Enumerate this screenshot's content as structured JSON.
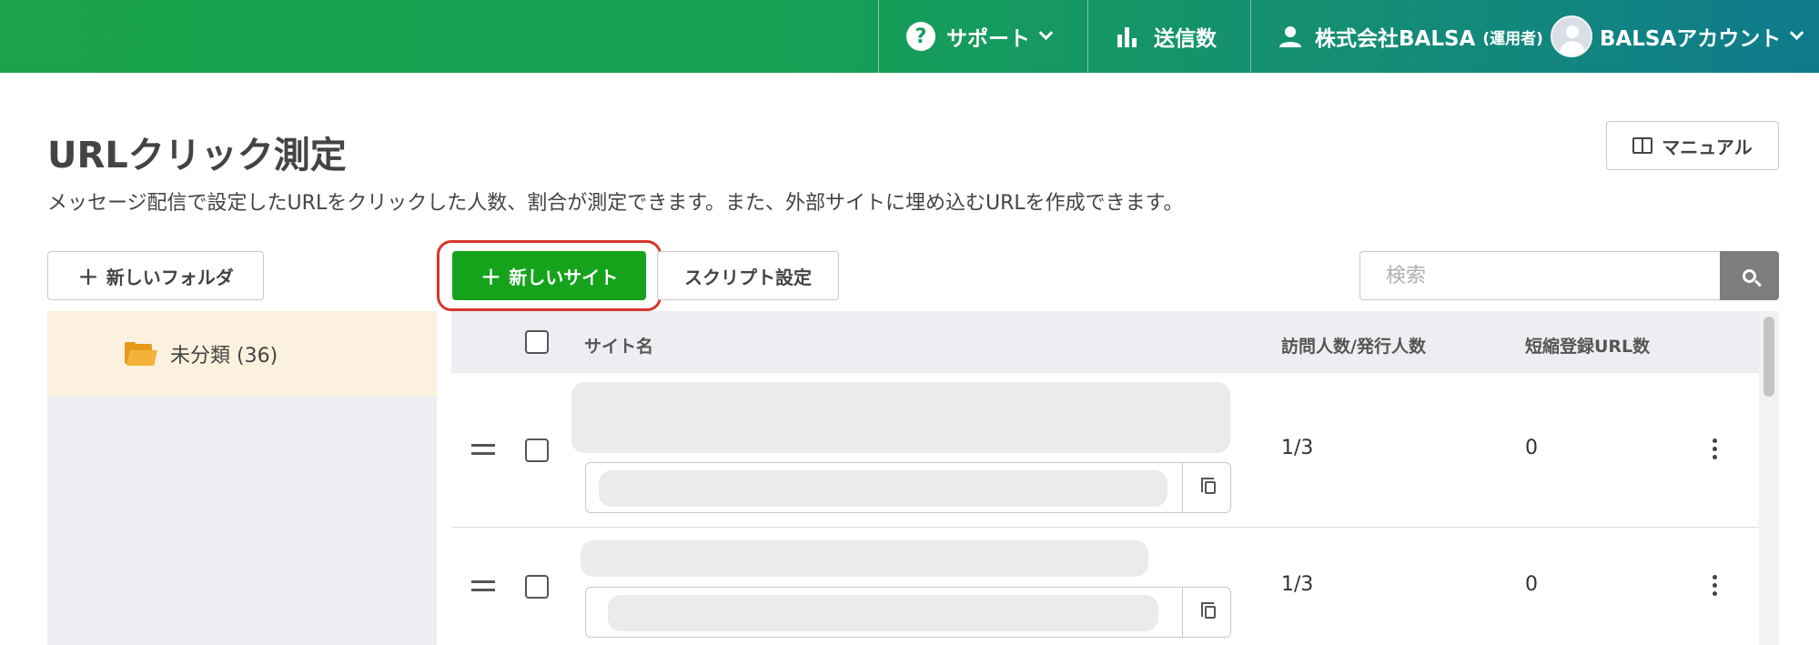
{
  "header": {
    "support_label": "サポート",
    "sends_label": "送信数",
    "company_label": "株式会社BALSA",
    "company_role": "(運用者)",
    "account_label": "BALSAアカウント"
  },
  "page": {
    "title": "URLクリック測定",
    "description": "メッセージ配信で設定したURLをクリックした人数、割合が測定できます。また、外部サイトに埋め込むURLを作成できます。",
    "manual_label": "マニュアル"
  },
  "toolbar": {
    "new_folder_label": "新しいフォルダ",
    "new_site_label": "新しいサイト",
    "script_settings_label": "スクリプト設定",
    "search_placeholder": "検索"
  },
  "sidebar": {
    "folders": [
      {
        "label": "未分類 (36)"
      }
    ]
  },
  "table": {
    "columns": [
      "サイト名",
      "訪問人数/発行人数",
      "短縮登録URL数"
    ],
    "rows": [
      {
        "visits": "1/3",
        "short_urls": "0"
      },
      {
        "visits": "1/3",
        "short_urls": "0"
      }
    ]
  },
  "colors": {
    "header_gradient_start": "#1aa34a",
    "header_gradient_end": "#0e7a8c",
    "primary_button": "#15a31c",
    "highlight_ring": "#d9342b",
    "selected_folder_bg": "#fbf1de",
    "folder_icon": "#e59a1a"
  },
  "icons": {
    "support": "question-circle-icon",
    "sends": "bar-chart-icon",
    "user": "user-icon",
    "manual": "book-icon",
    "search": "search-icon",
    "folder": "folder-open-icon",
    "copy": "copy-icon",
    "drag": "drag-handle-icon",
    "more": "kebab-menu-icon"
  }
}
